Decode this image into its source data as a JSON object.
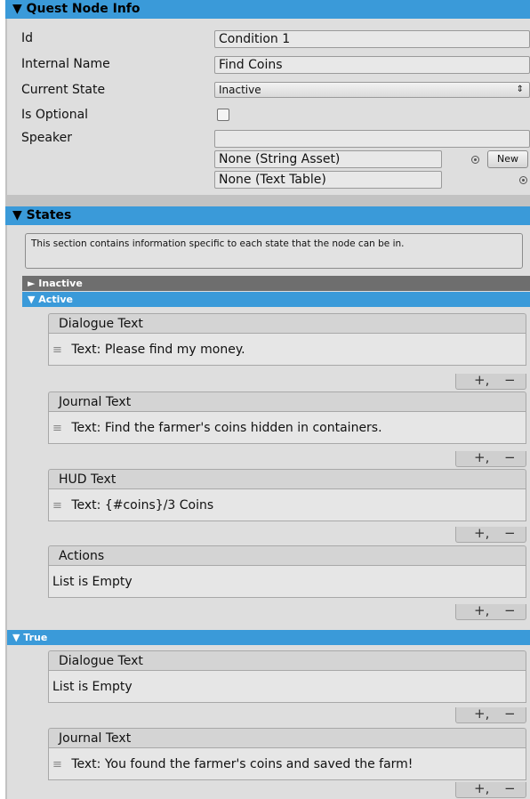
{
  "quest_node_info": {
    "header": "▼ Quest Node Info",
    "fields": {
      "id_label": "Id",
      "id_value": "Condition 1",
      "internal_name_label": "Internal Name",
      "internal_name_value": "Find Coins",
      "current_state_label": "Current State",
      "current_state_value": "Inactive",
      "is_optional_label": "Is Optional",
      "is_optional_checked": false,
      "speaker_label": "Speaker",
      "speaker_value": "",
      "string_asset_value": "None (String Asset)",
      "new_button_label": "New",
      "text_table_value": "None (Text Table)"
    }
  },
  "states": {
    "header": "▼ States",
    "help_text": "This section contains information specific to each state that the node can be in.",
    "inactive_header": "► Inactive",
    "active_header": "▼ Active",
    "active_lists": {
      "dialogue_title": "Dialogue Text",
      "dialogue_item": "Text: Please find my money.",
      "journal_title": "Journal Text",
      "journal_item": "Text: Find the farmer's coins hidden in containers.",
      "hud_title": "HUD Text",
      "hud_item": "Text: {#coins}/3 Coins",
      "actions_title": "Actions",
      "actions_item": "List is Empty"
    },
    "true_header": "▼ True",
    "true_lists": {
      "dialogue_title": "Dialogue Text",
      "dialogue_item": "List is Empty",
      "journal_title": "Journal Text",
      "journal_item": "Text: You found the farmer's coins and saved the farm!"
    },
    "list_controls": {
      "add": "+,",
      "remove": "−"
    }
  },
  "icons": {
    "grip": "≡",
    "dropdown_arrows": "⇕",
    "object_picker": "object-picker-icon"
  }
}
